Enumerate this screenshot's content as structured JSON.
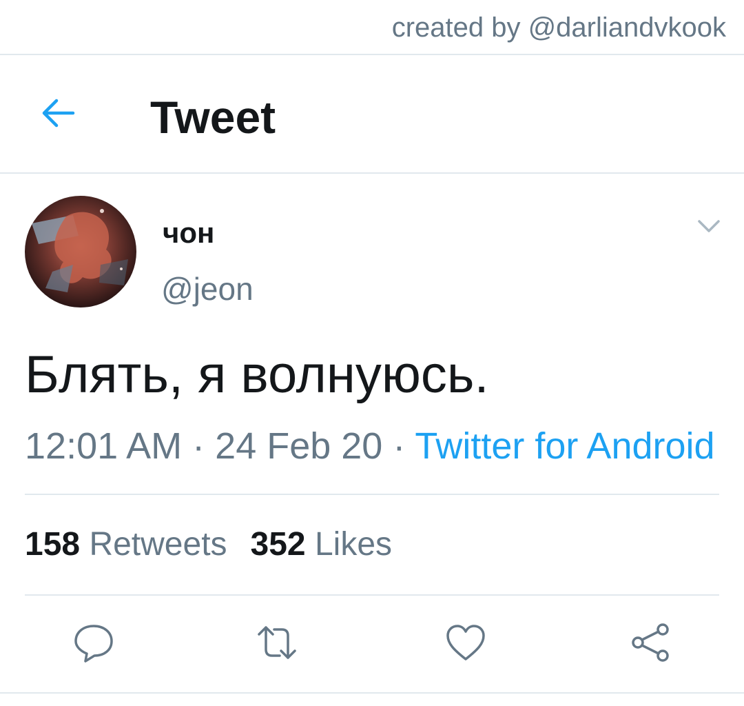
{
  "watermark": {
    "text": "created by @darliandvkook"
  },
  "header": {
    "title": "Tweet",
    "back_icon": "arrow-left-icon"
  },
  "tweet": {
    "display_name": "чон",
    "username": "@jeon",
    "text": "Блять, я волнуюсь.",
    "time": "12:01 AM",
    "date": "24 Feb 20",
    "separator": " · ",
    "source": "Twitter for Android",
    "retweets_count": "158",
    "retweets_label": "Retweets",
    "likes_count": "352",
    "likes_label": "Likes"
  },
  "actions": [
    "reply-icon",
    "retweet-icon",
    "like-icon",
    "share-icon"
  ],
  "colors": {
    "accent": "#1da1f2",
    "text_primary": "#14171a",
    "text_secondary": "#657786",
    "divider": "#e1e8ed"
  }
}
